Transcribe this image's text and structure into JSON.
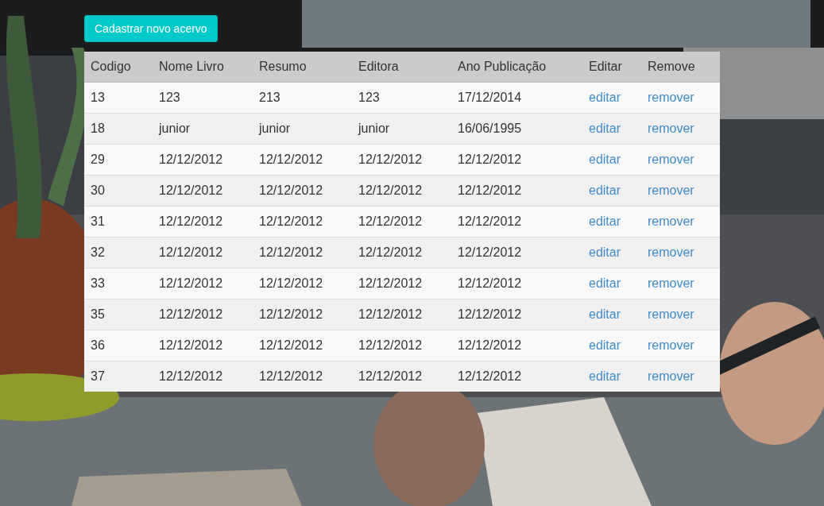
{
  "new_button": "Cadastrar novo acervo",
  "table": {
    "columns": [
      "Codigo",
      "Nome Livro",
      "Resumo",
      "Editora",
      "Ano Publicação",
      "Editar",
      "Remove"
    ],
    "rows": [
      {
        "cells": [
          "13",
          "123",
          "213",
          "123",
          "17/12/2014"
        ],
        "edit": "editar",
        "remove": "remover"
      },
      {
        "cells": [
          "18",
          "junior",
          "junior",
          "junior",
          "16/06/1995"
        ],
        "edit": "editar",
        "remove": "remover"
      },
      {
        "cells": [
          "29",
          "12/12/2012",
          "12/12/2012",
          "12/12/2012",
          "12/12/2012"
        ],
        "edit": "editar",
        "remove": "remover"
      },
      {
        "cells": [
          "30",
          "12/12/2012",
          "12/12/2012",
          "12/12/2012",
          "12/12/2012"
        ],
        "edit": "editar",
        "remove": "remover"
      },
      {
        "cells": [
          "31",
          "12/12/2012",
          "12/12/2012",
          "12/12/2012",
          "12/12/2012"
        ],
        "edit": "editar",
        "remove": "remover"
      },
      {
        "cells": [
          "32",
          "12/12/2012",
          "12/12/2012",
          "12/12/2012",
          "12/12/2012"
        ],
        "edit": "editar",
        "remove": "remover"
      },
      {
        "cells": [
          "33",
          "12/12/2012",
          "12/12/2012",
          "12/12/2012",
          "12/12/2012"
        ],
        "edit": "editar",
        "remove": "remover"
      },
      {
        "cells": [
          "35",
          "12/12/2012",
          "12/12/2012",
          "12/12/2012",
          "12/12/2012"
        ],
        "edit": "editar",
        "remove": "remover"
      },
      {
        "cells": [
          "36",
          "12/12/2012",
          "12/12/2012",
          "12/12/2012",
          "12/12/2012"
        ],
        "edit": "editar",
        "remove": "remover"
      },
      {
        "cells": [
          "37",
          "12/12/2012",
          "12/12/2012",
          "12/12/2012",
          "12/12/2012"
        ],
        "edit": "editar",
        "remove": "remover"
      }
    ]
  }
}
